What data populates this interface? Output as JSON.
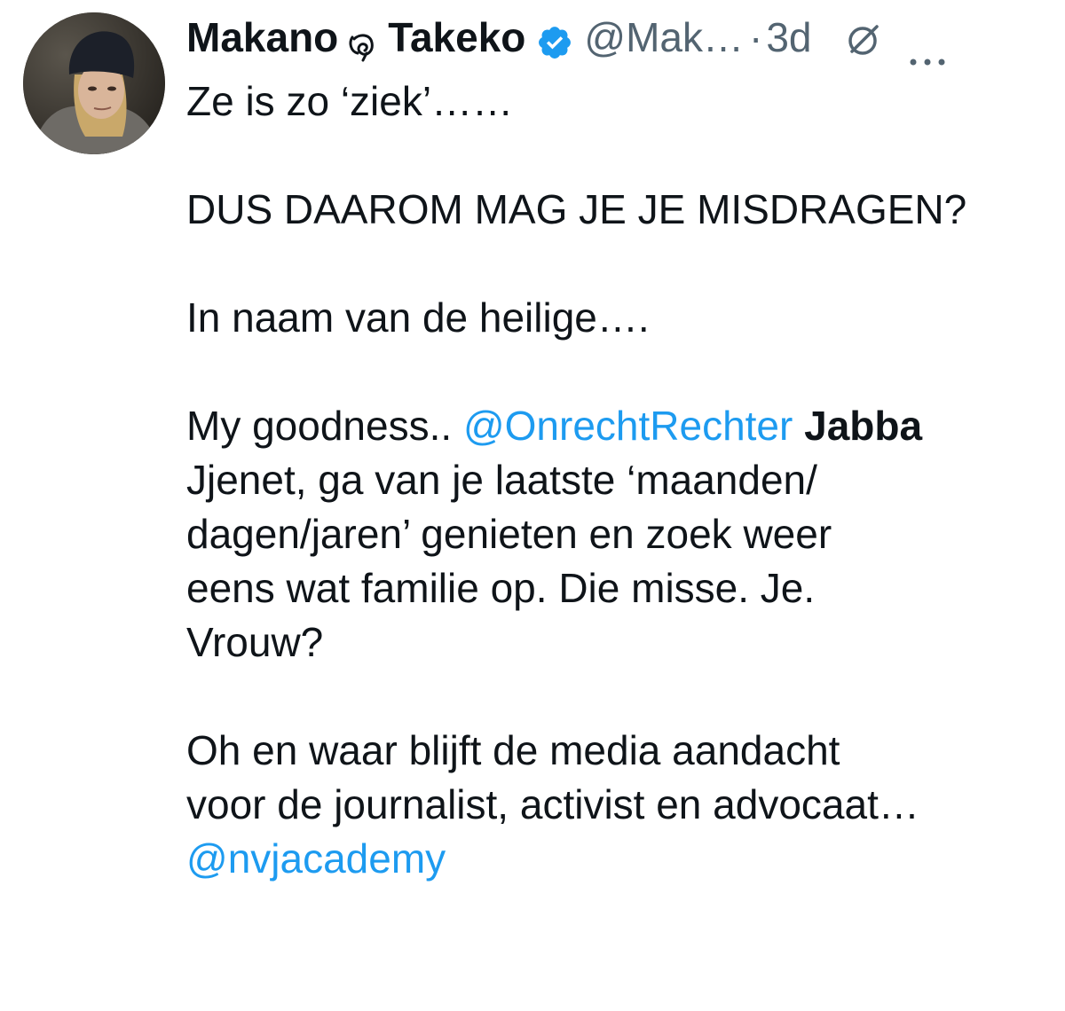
{
  "tweet": {
    "author": {
      "first_name": "Makano",
      "last_name": "Takeko",
      "handle": "@Mak…",
      "verified": true,
      "avatar": "profile-photo"
    },
    "separator": "·",
    "time": "3d",
    "icons": [
      "verified-badge-icon",
      "grok-icon",
      "more-options-icon"
    ],
    "body": {
      "line1": "Ze is zo ‘ziek’……",
      "line2": "DUS DAAROM MAG JE JE MISDRAGEN?",
      "line3": "In naam van de heilige….",
      "p4_start": "My goodness.. ",
      "p4_mention": "@OnrechtRechter",
      "p4_bold": "Jabba",
      "p4_rest_1": "Jjenet, ga van je laatste ‘maanden/",
      "p4_rest_2": "dagen/jaren’ genieten en zoek weer",
      "p4_rest_3": "eens wat familie op. Die misse. Je.",
      "p4_rest_4": "Vrouw?",
      "p5_line1": "Oh en waar blijft de media aandacht",
      "p5_line2": "voor de journalist, activist en advocaat…",
      "p5_mention": "@nvjacademy"
    }
  },
  "colors": {
    "text": "#0f1419",
    "secondary": "#536471",
    "link": "#1d9bf0",
    "verified": "#1d9bf0"
  }
}
